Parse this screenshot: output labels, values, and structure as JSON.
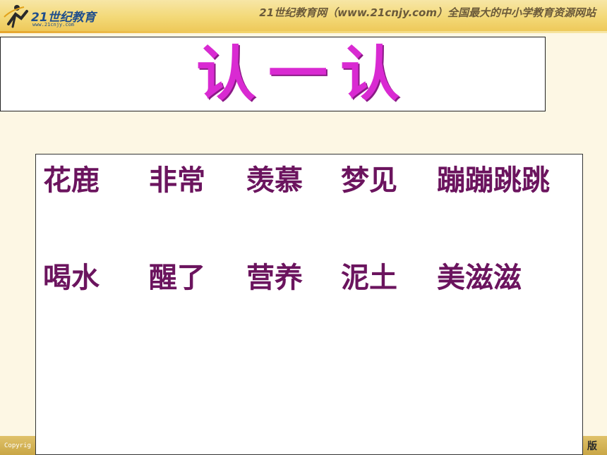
{
  "header": {
    "logo_text": "21世纪教育",
    "logo_url": "www.21cnjy.com",
    "site_banner": "21世纪教育网（www.21cnjy.com）全国最大的中小学教育资源网站"
  },
  "title": "认一认",
  "words": {
    "row1": [
      "花鹿",
      "非常",
      "羡慕",
      "梦见",
      "蹦蹦跳跳"
    ],
    "row2": [
      "喝水",
      "醒了",
      "营养",
      "泥土",
      "美滋滋"
    ]
  },
  "footer": {
    "left_text": "Copyrig",
    "right_text": "版"
  },
  "colors": {
    "title": "#d92ad2",
    "words": "#6b145e",
    "header_band": "#f3d978",
    "footer_band": "#c9a646"
  }
}
